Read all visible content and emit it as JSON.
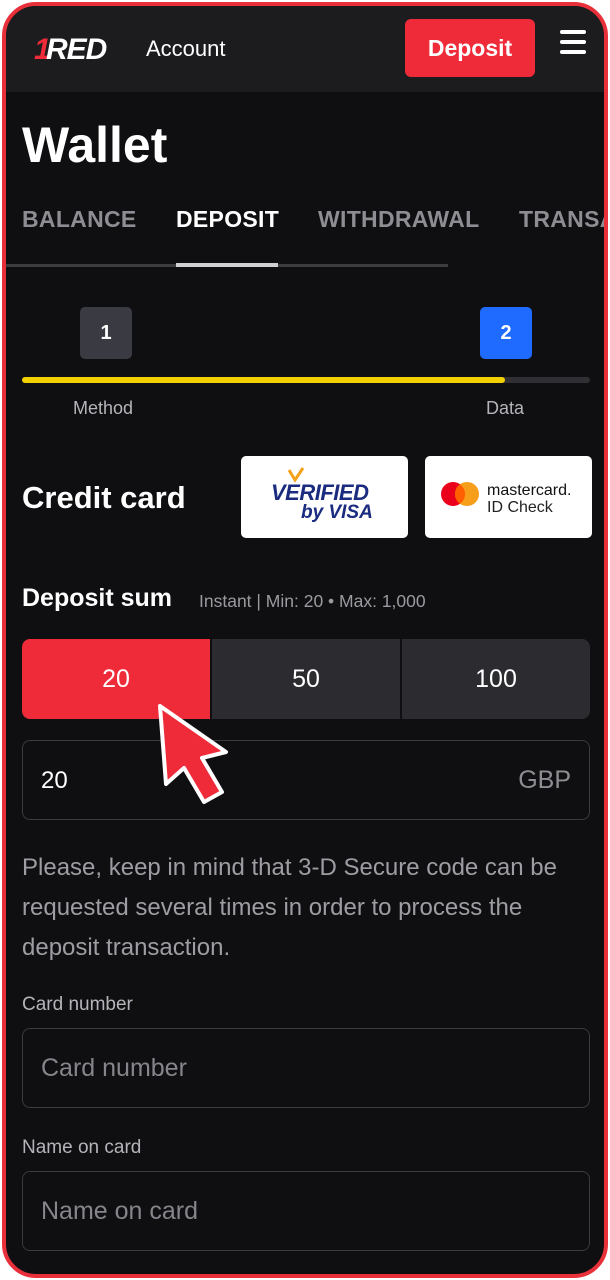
{
  "header": {
    "logo_text": "RED",
    "account_label": "Account",
    "deposit_button": "Deposit",
    "menu_icon": "hamburger-menu-icon"
  },
  "page_title": "Wallet",
  "tabs": [
    {
      "label": "BALANCE",
      "active": false
    },
    {
      "label": "DEPOSIT",
      "active": true
    },
    {
      "label": "WITHDRAWAL",
      "active": false
    },
    {
      "label": "TRANSA",
      "active": false
    }
  ],
  "stepper": {
    "progress": 0.85,
    "steps": [
      {
        "number": "1",
        "label": "Method"
      },
      {
        "number": "2",
        "label": "Data"
      }
    ]
  },
  "payment": {
    "method_title": "Credit card",
    "visa_logo": {
      "line1": "VERIFIED",
      "line2": "by VISA"
    },
    "mastercard_logo": {
      "line1": "mastercard.",
      "line2": "ID Check"
    }
  },
  "deposit_sum": {
    "title": "Deposit sum",
    "info": "Instant | Min: 20 • Max: 1,000",
    "amount_options": [
      "20",
      "50",
      "100"
    ],
    "selected_option": "20",
    "amount_value": "20",
    "currency": "GBP"
  },
  "note": "Please, keep in mind that 3-D Secure code can be requested several times in order to process the deposit transaction.",
  "fields": {
    "card_number": {
      "label": "Card number",
      "placeholder": "Card number"
    },
    "name_on_card": {
      "label": "Name on card",
      "placeholder": "Name on card"
    }
  },
  "colors": {
    "accent_red": "#ef2b3a",
    "step_active_blue": "#1f6bff",
    "progress_yellow": "#f3d000",
    "background": "#0f0f11"
  }
}
